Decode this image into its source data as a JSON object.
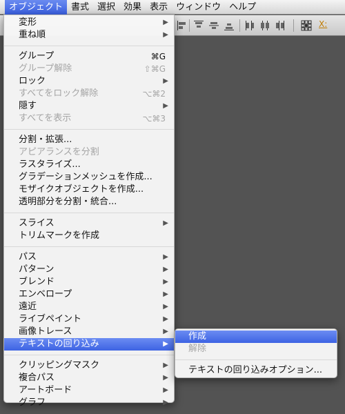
{
  "menubar": {
    "items": [
      {
        "label": "オブジェクト",
        "active": true
      },
      {
        "label": "書式"
      },
      {
        "label": "選択"
      },
      {
        "label": "効果"
      },
      {
        "label": "表示"
      },
      {
        "label": "ウィンドウ"
      },
      {
        "label": "ヘルプ"
      }
    ]
  },
  "controlbar": {
    "x_label": "X:"
  },
  "object_menu": {
    "groups": [
      [
        {
          "label": "変形",
          "submenu": true
        },
        {
          "label": "重ね順",
          "submenu": true
        }
      ],
      [
        {
          "label": "グループ",
          "shortcut": "⌘G"
        },
        {
          "label": "グループ解除",
          "shortcut": "⇧⌘G",
          "disabled": true
        },
        {
          "label": "ロック",
          "submenu": true
        },
        {
          "label": "すべてをロック解除",
          "shortcut": "⌥⌘2",
          "disabled": true
        },
        {
          "label": "隠す",
          "submenu": true
        },
        {
          "label": "すべてを表示",
          "shortcut": "⌥⌘3",
          "disabled": true
        }
      ],
      [
        {
          "label": "分割・拡張..."
        },
        {
          "label": "アピアランスを分割",
          "disabled": true
        },
        {
          "label": "ラスタライズ..."
        },
        {
          "label": "グラデーションメッシュを作成..."
        },
        {
          "label": "モザイクオブジェクトを作成..."
        },
        {
          "label": "透明部分を分割・統合..."
        }
      ],
      [
        {
          "label": "スライス",
          "submenu": true
        },
        {
          "label": "トリムマークを作成"
        }
      ],
      [
        {
          "label": "パス",
          "submenu": true
        },
        {
          "label": "パターン",
          "submenu": true
        },
        {
          "label": "ブレンド",
          "submenu": true
        },
        {
          "label": "エンベロープ",
          "submenu": true
        },
        {
          "label": "遠近",
          "submenu": true
        },
        {
          "label": "ライブペイント",
          "submenu": true
        },
        {
          "label": "画像トレース",
          "submenu": true
        },
        {
          "label": "テキストの回り込み",
          "submenu": true,
          "highlight": true
        }
      ],
      [
        {
          "label": "クリッピングマスク",
          "submenu": true
        },
        {
          "label": "複合パス",
          "submenu": true
        },
        {
          "label": "アートボード",
          "submenu": true
        },
        {
          "label": "グラフ",
          "submenu": true
        }
      ]
    ]
  },
  "text_wrap_submenu": {
    "groups": [
      [
        {
          "label": "作成",
          "highlight": true
        },
        {
          "label": "解除",
          "disabled": true
        }
      ],
      [
        {
          "label": "テキストの回り込みオプション..."
        }
      ]
    ]
  },
  "icons": {
    "submenu_arrow": "▶"
  }
}
